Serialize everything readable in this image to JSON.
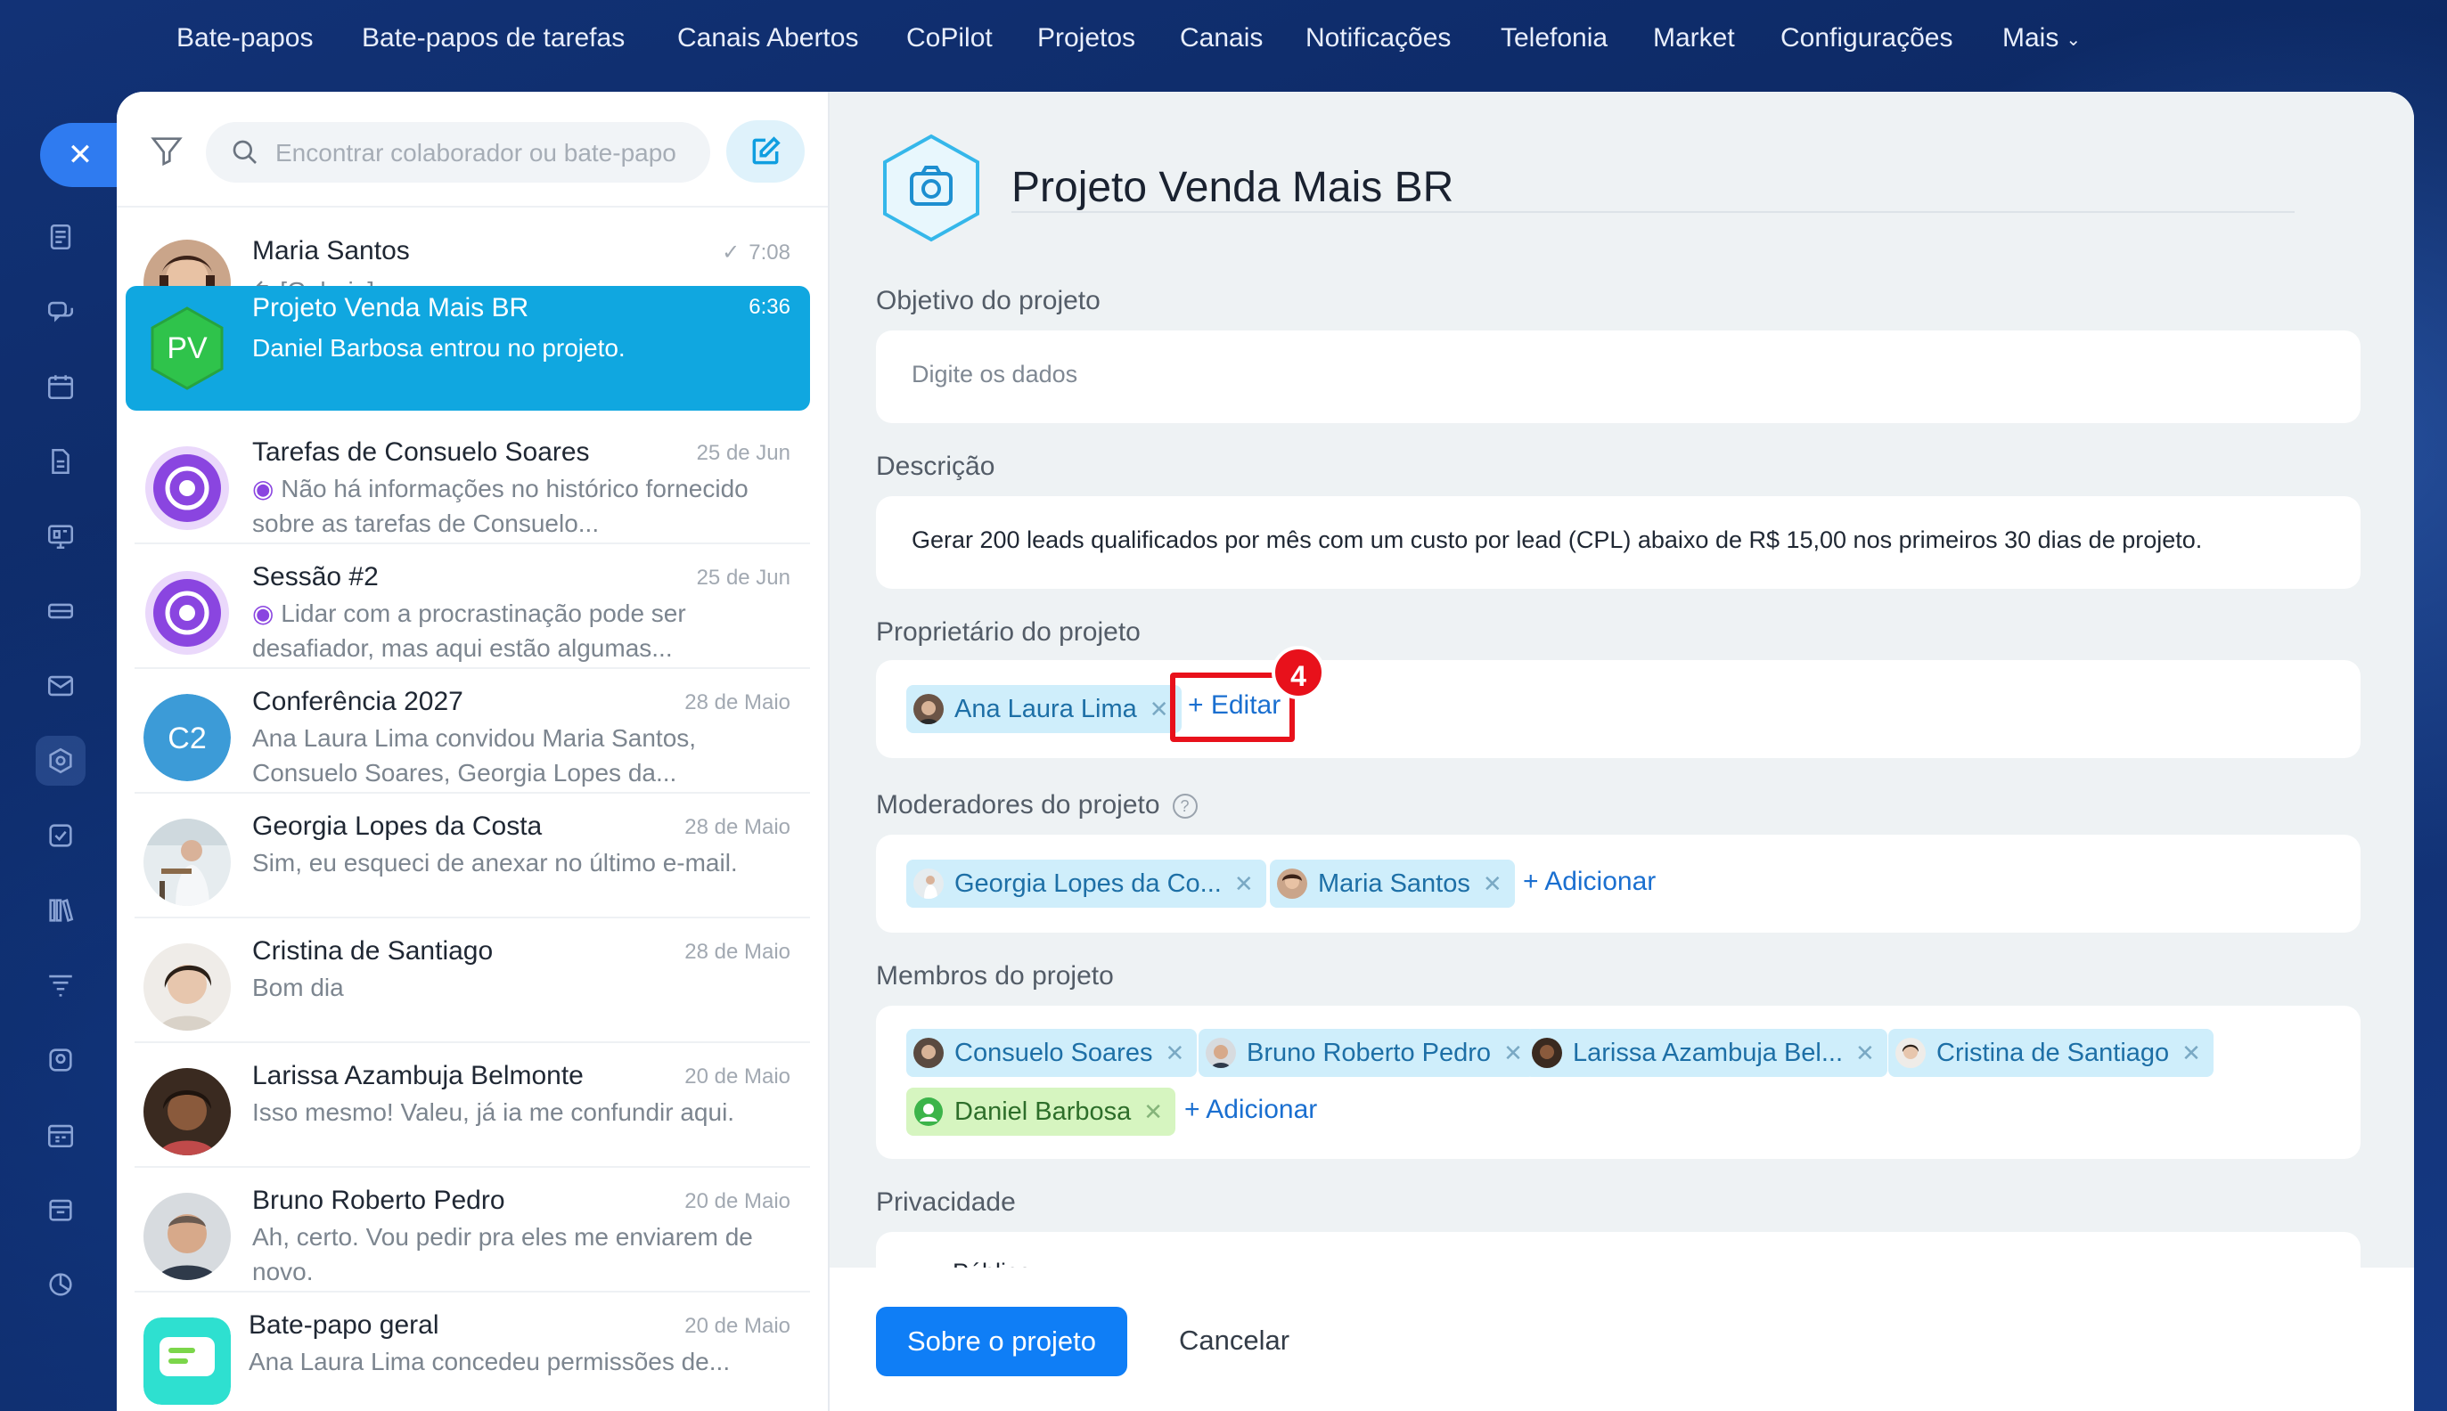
{
  "topnav": {
    "items": [
      "Bate-papos",
      "Bate-papos de tarefas",
      "Canais Abertos",
      "CoPilot",
      "Projetos",
      "Canais",
      "Notificações",
      "Telefonia",
      "Market",
      "Configurações",
      "Mais"
    ]
  },
  "search": {
    "placeholder": "Encontrar colaborador ou bate-papo"
  },
  "chats": [
    {
      "name": "Maria Santos",
      "time": "7:08",
      "message": "[Galeria]"
    },
    {
      "name": "Projeto Venda Mais BR",
      "time": "6:36",
      "message": "Daniel Barbosa entrou no projeto.",
      "initials": "PV"
    },
    {
      "name": "Tarefas de Consuelo Soares",
      "time": "25 de Jun",
      "message": "Não há informações no histórico fornecido sobre as tarefas de Consuelo..."
    },
    {
      "name": "Sessão #2",
      "time": "25 de Jun",
      "message": "Lidar com a procrastinação pode ser desafiador, mas aqui estão algumas..."
    },
    {
      "name": "Conferência 2027",
      "time": "28 de Maio",
      "message": "Ana Laura Lima convidou Maria Santos, Consuelo Soares, Georgia Lopes da...",
      "initials": "C2"
    },
    {
      "name": "Georgia Lopes da Costa",
      "time": "28 de Maio",
      "message": "Sim, eu esqueci de anexar no último e-mail."
    },
    {
      "name": "Cristina de Santiago",
      "time": "28 de Maio",
      "message": "Bom dia"
    },
    {
      "name": "Larissa Azambuja Belmonte",
      "time": "20 de Maio",
      "message": "Isso mesmo! Valeu, já ia me confundir aqui."
    },
    {
      "name": "Bruno Roberto Pedro",
      "time": "20 de Maio",
      "message": "Ah, certo. Vou pedir pra eles me enviarem de novo."
    },
    {
      "name": "Bate-papo geral",
      "time": "20 de Maio",
      "message": "Ana Laura Lima concedeu permissões de..."
    }
  ],
  "project": {
    "title": "Projeto Venda Mais BR",
    "goal_label": "Objetivo do projeto",
    "goal_placeholder": "Digite os dados",
    "description_label": "Descrição",
    "description": "Gerar 200 leads qualificados por mês com um custo por lead (CPL) abaixo de R$ 15,00 nos primeiros 30 dias de projeto.",
    "owner_label": "Proprietário do projeto",
    "owner": "Ana Laura Lima",
    "edit_label": "+ Editar",
    "step_badge": "4",
    "moderators_label": "Moderadores do projeto",
    "moderators": [
      "Georgia Lopes da Co...",
      "Maria Santos"
    ],
    "add_label": "+ Adicionar",
    "members_label": "Membros do projeto",
    "members": [
      "Consuelo Soares",
      "Bruno Roberto Pedro",
      "Larissa Azambuja Bel...",
      "Cristina de Santiago",
      "Daniel Barbosa"
    ],
    "privacy_label": "Privacidade",
    "privacy_value": "Público"
  },
  "footer": {
    "primary": "Sobre o projeto",
    "cancel": "Cancelar"
  },
  "colors": {
    "accent": "#0f7ef6",
    "active_row": "#10a7e0",
    "highlight": "#e8111b"
  }
}
